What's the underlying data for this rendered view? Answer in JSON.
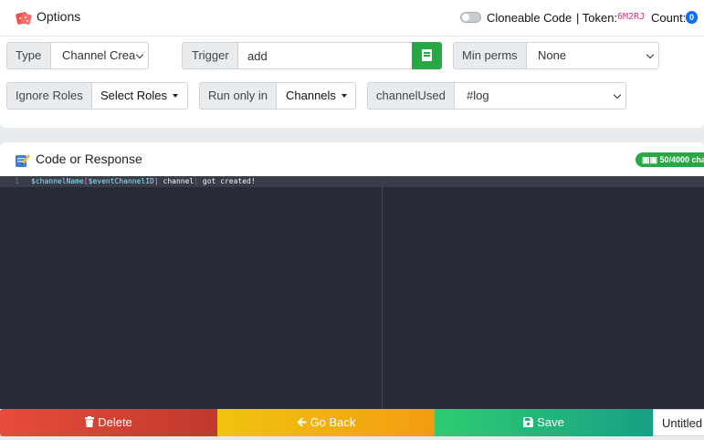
{
  "options": {
    "title": "Options",
    "cloneable_label": "Cloneable Code",
    "token_label": "| Token:",
    "token_value": "6M2RJ",
    "count_label": "Count:",
    "count_value": "0"
  },
  "fields": {
    "type_label": "Type",
    "type_value": "Channel Crea",
    "trigger_label": "Trigger",
    "trigger_value": "add",
    "min_perms_label": "Min perms",
    "min_perms_value": "None",
    "ignore_roles_label": "Ignore Roles",
    "select_roles_label": "Select Roles",
    "run_only_label": "Run only in",
    "channels_label": "Channels",
    "channel_used_label": "channelUsed",
    "channel_used_value": "#log"
  },
  "code": {
    "title": "Code or Response",
    "char_count": "50/4000 cha",
    "line_number": "1",
    "tokens": [
      "$channelName",
      "[",
      "$eventChannelID",
      "]",
      " channel",
      " got created!"
    ]
  },
  "actions": {
    "delete_label": "Delete",
    "back_label": "Go Back",
    "save_label": "Save",
    "name_value": "Untitled"
  },
  "colors": {
    "delete": "#e74c3c",
    "back": "#f1c40f",
    "save": "#2ecc71",
    "editor_bg": "#282a36"
  },
  "icons": {
    "options": "dice-icon",
    "code": "pencil-note-icon",
    "delete": "trash-icon",
    "back": "arrow-left-icon",
    "save": "floppy-icon",
    "trigger_help": "book-icon"
  }
}
